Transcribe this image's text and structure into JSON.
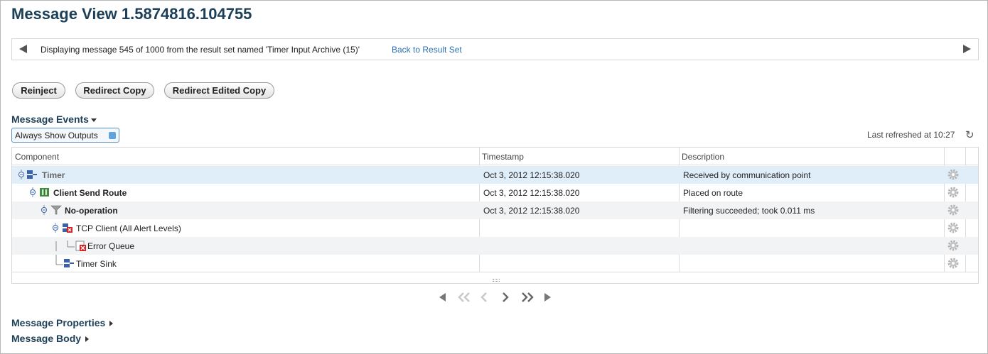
{
  "page": {
    "title": "Message View 1.5874816.104755"
  },
  "navbar": {
    "text": "Displaying message 545 of 1000 from the result set named 'Timer Input Archive (15)'",
    "link": "Back to Result Set"
  },
  "actions": {
    "reinject": "Reinject",
    "redirect_copy": "Redirect Copy",
    "redirect_edited_copy": "Redirect Edited Copy"
  },
  "events": {
    "title": "Message Events",
    "toggle_label": "Always Show Outputs",
    "last_refreshed": "Last refreshed at 10:27",
    "columns": {
      "component": "Component",
      "timestamp": "Timestamp",
      "description": "Description"
    },
    "rows": [
      {
        "component": "Timer",
        "timestamp": "Oct 3, 2012 12:15:38.020",
        "description": "Received by communication point",
        "icon": "communication-point-icon"
      },
      {
        "component": "Client Send Route",
        "timestamp": "Oct 3, 2012 12:15:38.020",
        "description": "Placed on route",
        "icon": "route-icon"
      },
      {
        "component": "No-operation",
        "timestamp": "Oct 3, 2012 12:15:38.020",
        "description": "Filtering succeeded; took 0.011 ms",
        "icon": "filter-icon"
      },
      {
        "component": "TCP Client (All Alert Levels)",
        "timestamp": "",
        "description": "",
        "icon": "communication-point-error-icon"
      },
      {
        "component": "Error Queue",
        "timestamp": "",
        "description": "",
        "icon": "error-queue-icon"
      },
      {
        "component": "Timer Sink",
        "timestamp": "",
        "description": "",
        "icon": "communication-point-icon"
      }
    ]
  },
  "sections": {
    "properties": "Message Properties",
    "body": "Message Body"
  },
  "colors": {
    "title": "#1d3f57",
    "link": "#2a6fb0",
    "selected_row": "#e0eef9"
  }
}
